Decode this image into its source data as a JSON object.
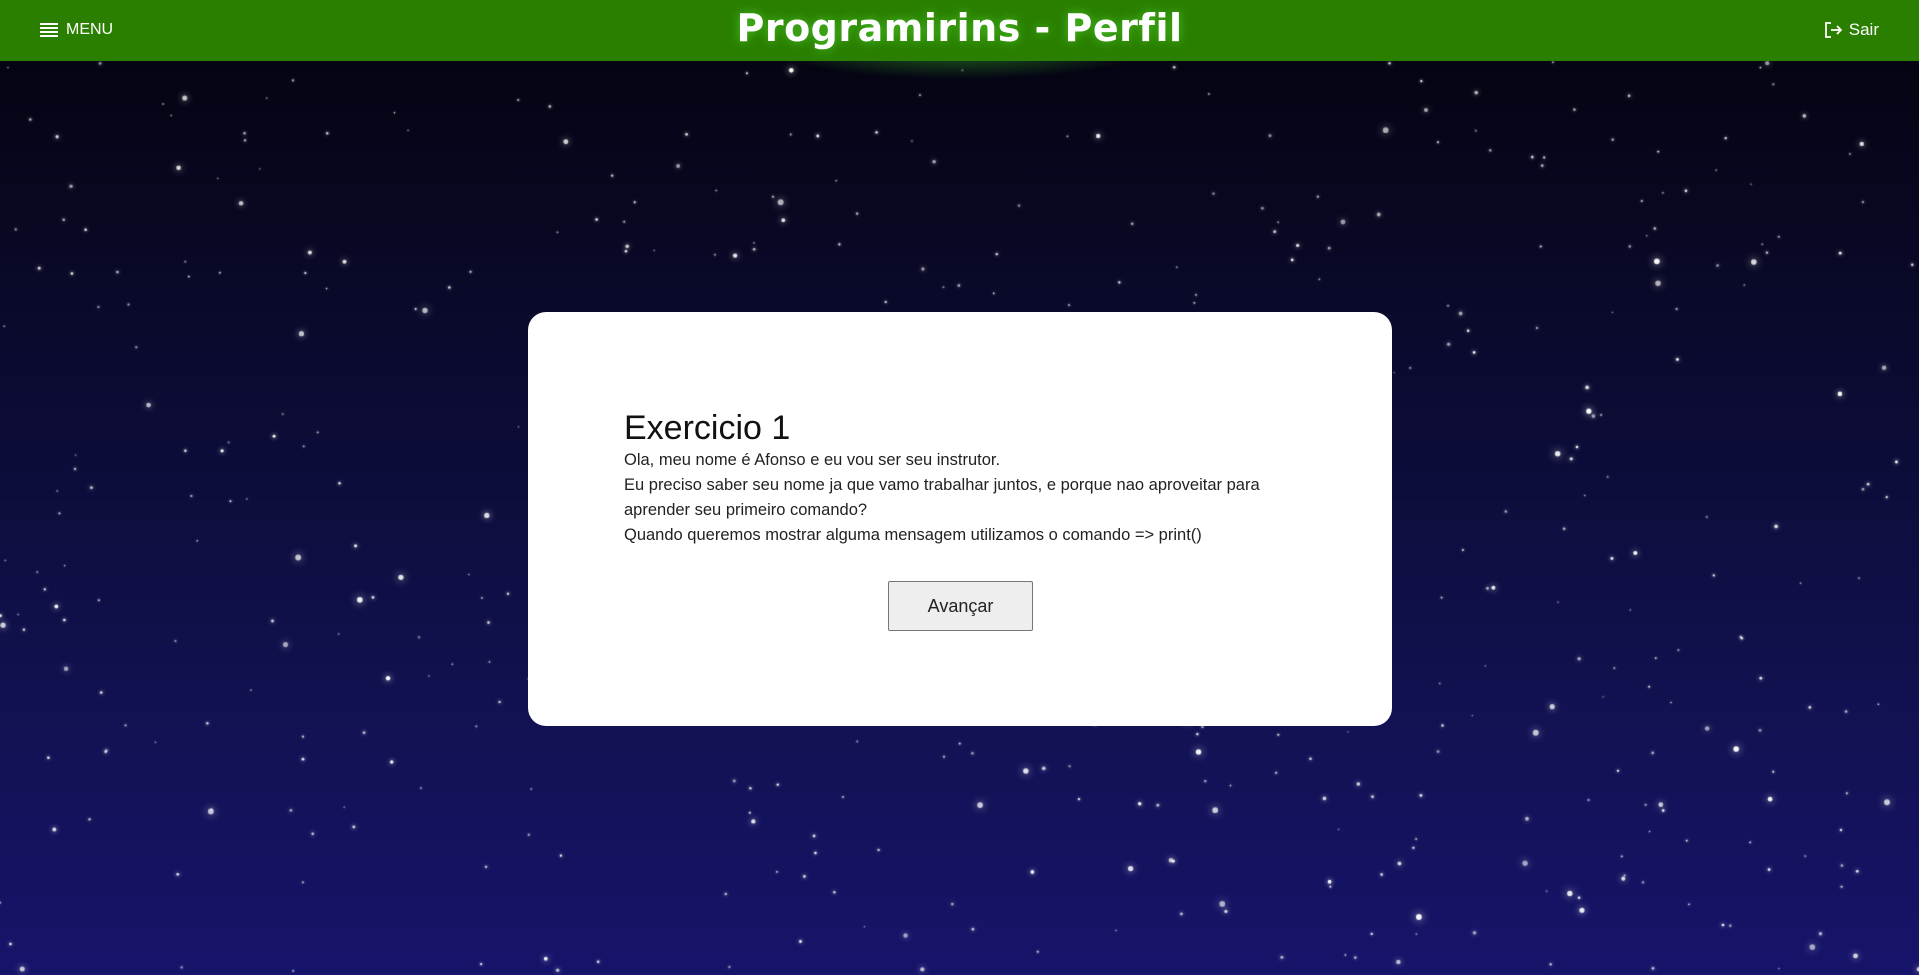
{
  "header": {
    "menu_label": "MENU",
    "menu_icon": "hamburger-menu-icon",
    "title": "Programirins - Perfil",
    "logout_label": "Sair",
    "logout_icon": "logout-icon",
    "bar_color": "#2a7f00"
  },
  "exercise": {
    "title": "Exercicio 1",
    "lines": [
      "Ola, meu nome é Afonso e eu vou ser seu instrutor.",
      "Eu preciso saber seu nome ja que vamo trabalhar juntos, e porque nao aproveitar para aprender seu primeiro comando?",
      "Quando queremos mostrar alguma mensagem utilizamos o comando => print()"
    ],
    "advance_label": "Avançar"
  },
  "background": {
    "top_color": "#04030d",
    "bottom_color": "#16146a",
    "star_color": "#ffffff"
  }
}
